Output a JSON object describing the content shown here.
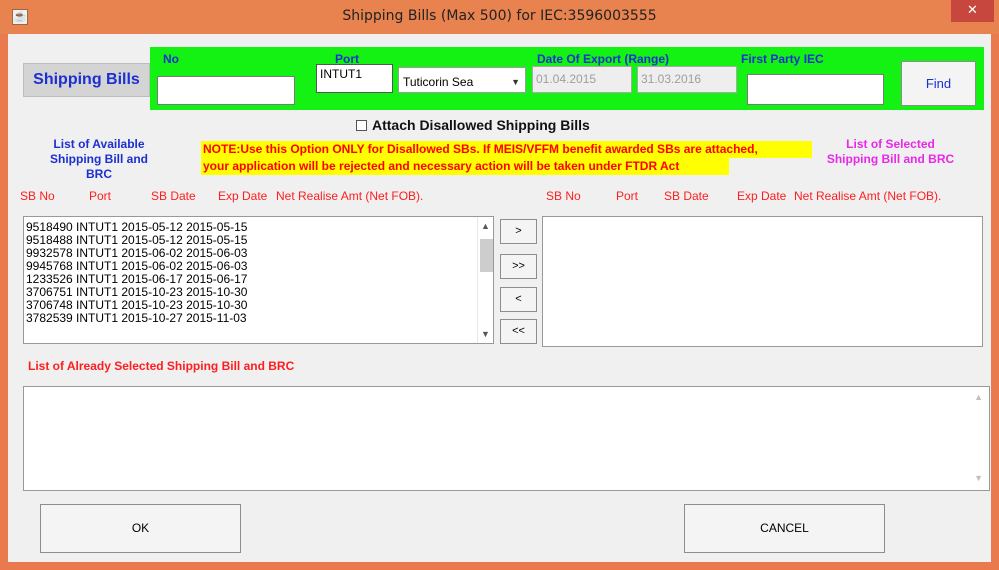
{
  "window": {
    "title": "Shipping Bills (Max 500) for IEC:3596003555",
    "close_glyph": "✕",
    "app_icon": "java-cup-icon"
  },
  "header": {
    "section_label": "Shipping Bills",
    "no_label": "No",
    "port_label": "Port",
    "date_label": "Date Of Export (Range)",
    "first_party_label": "First Party IEC",
    "no_value": "",
    "port_code": "INTUT1",
    "port_name": "Tuticorin Sea",
    "date_from": "01.04.2015",
    "date_to": "31.03.2016",
    "first_party_value": "",
    "find_label": "Find"
  },
  "attach": {
    "label": "Attach Disallowed Shipping Bills",
    "checked": false
  },
  "available": {
    "title_line1": "List of Available",
    "title_line2": "Shipping Bill and BRC",
    "columns": [
      "SB No",
      "Port",
      "SB Date",
      "Exp Date",
      "Net Realise Amt (Net FOB)."
    ],
    "rows": [
      "9518490 INTUT1 2015-05-12 2015-05-15",
      "9518488 INTUT1 2015-05-12 2015-05-15",
      "9932578 INTUT1 2015-06-02 2015-06-03",
      "9945768 INTUT1 2015-06-02 2015-06-03",
      "1233526 INTUT1 2015-06-17 2015-06-17",
      "3706751 INTUT1 2015-10-23 2015-10-30",
      "3706748 INTUT1 2015-10-23 2015-10-30",
      "3782539 INTUT1 2015-10-27 2015-11-03"
    ]
  },
  "note": {
    "line1": "NOTE:Use this Option ONLY for Disallowed SBs. If MEIS/VFFM benefit awarded SBs are attached,",
    "line2": "your application will be rejected and  necessary action will be taken under FTDR Act"
  },
  "selected": {
    "title_line1": "List of  Selected",
    "title_line2": "Shipping Bill and BRC",
    "columns": [
      "SB No",
      "Port",
      "SB Date",
      "Exp Date",
      "Net Realise Amt (Net FOB)."
    ]
  },
  "move_buttons": {
    "add_one": ">",
    "add_all": ">>",
    "remove_one": "<",
    "remove_all": "<<"
  },
  "already_selected": {
    "title": "List of  Already Selected Shipping Bill and BRC"
  },
  "footer": {
    "ok_label": "OK",
    "cancel_label": "CANCEL"
  },
  "colors": {
    "title_bar": "#e8834f",
    "header_panel": "#13f213",
    "label_blue": "#1c2fd1",
    "warning_red": "#ff1e1e",
    "note_yellow": "#ffff00",
    "selected_title_magenta": "#e829e8"
  }
}
